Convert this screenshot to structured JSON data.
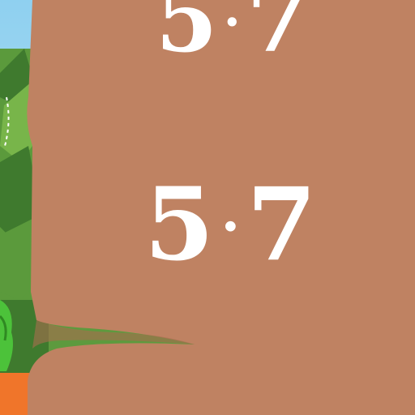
{
  "colors": {
    "board": "#bf8262",
    "board_shadow": "#a96c4f",
    "leaf_dark": "#3f7a2e",
    "leaf_mid": "#5b9a3c",
    "leaf_light": "#78b54a",
    "frog": "#4cc23a",
    "ground": "#f0752a",
    "sky": "#9fd8f1",
    "text": "#ffffff"
  },
  "problems": [
    {
      "a": "5",
      "op": "·",
      "b": "7"
    },
    {
      "a": "5",
      "op": "·",
      "b": "7"
    }
  ],
  "icons": [
    "jungle-background",
    "frog-character",
    "tree-stump-board"
  ]
}
